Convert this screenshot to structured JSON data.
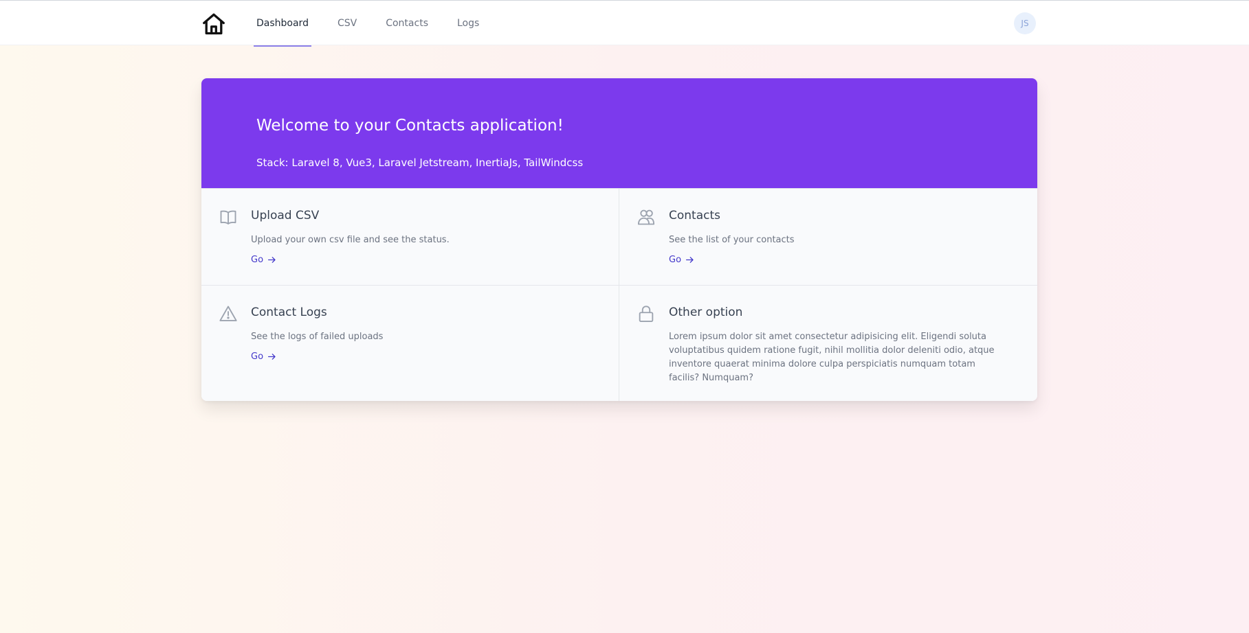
{
  "nav": {
    "items": [
      {
        "label": "Dashboard",
        "active": true
      },
      {
        "label": "CSV",
        "active": false
      },
      {
        "label": "Contacts",
        "active": false
      },
      {
        "label": "Logs",
        "active": false
      }
    ],
    "avatar_initials": "JS",
    "logo_icon": "home-icon"
  },
  "hero": {
    "title": "Welcome to your Contacts application!",
    "subtitle": "Stack: Laravel 8, Vue3, Laravel Jetstream, InertiaJs, TailWindcss",
    "background_color": "#7c3aed"
  },
  "cards": [
    {
      "icon": "book-icon",
      "title": "Upload CSV",
      "description": "Upload your own csv file and see the status.",
      "link": "Go"
    },
    {
      "icon": "users-icon",
      "title": "Contacts",
      "description": "See the list of your contacts",
      "link": "Go"
    },
    {
      "icon": "warning-icon",
      "title": "Contact Logs",
      "description": "See the logs of failed uploads",
      "link": "Go"
    },
    {
      "icon": "lock-icon",
      "title": "Other option",
      "description": "Lorem ipsum dolor sit amet consectetur adipisicing elit. Eligendi soluta voluptatibus quidem ratione fugit, nihil mollitia dolor deleniti odio, atque inventore quaerat minima dolore culpa perspiciatis numquam totam facilis? Numquam?",
      "link": ""
    }
  ],
  "colors": {
    "accent": "#4338ca",
    "nav_underline": "#8b7fe8"
  }
}
